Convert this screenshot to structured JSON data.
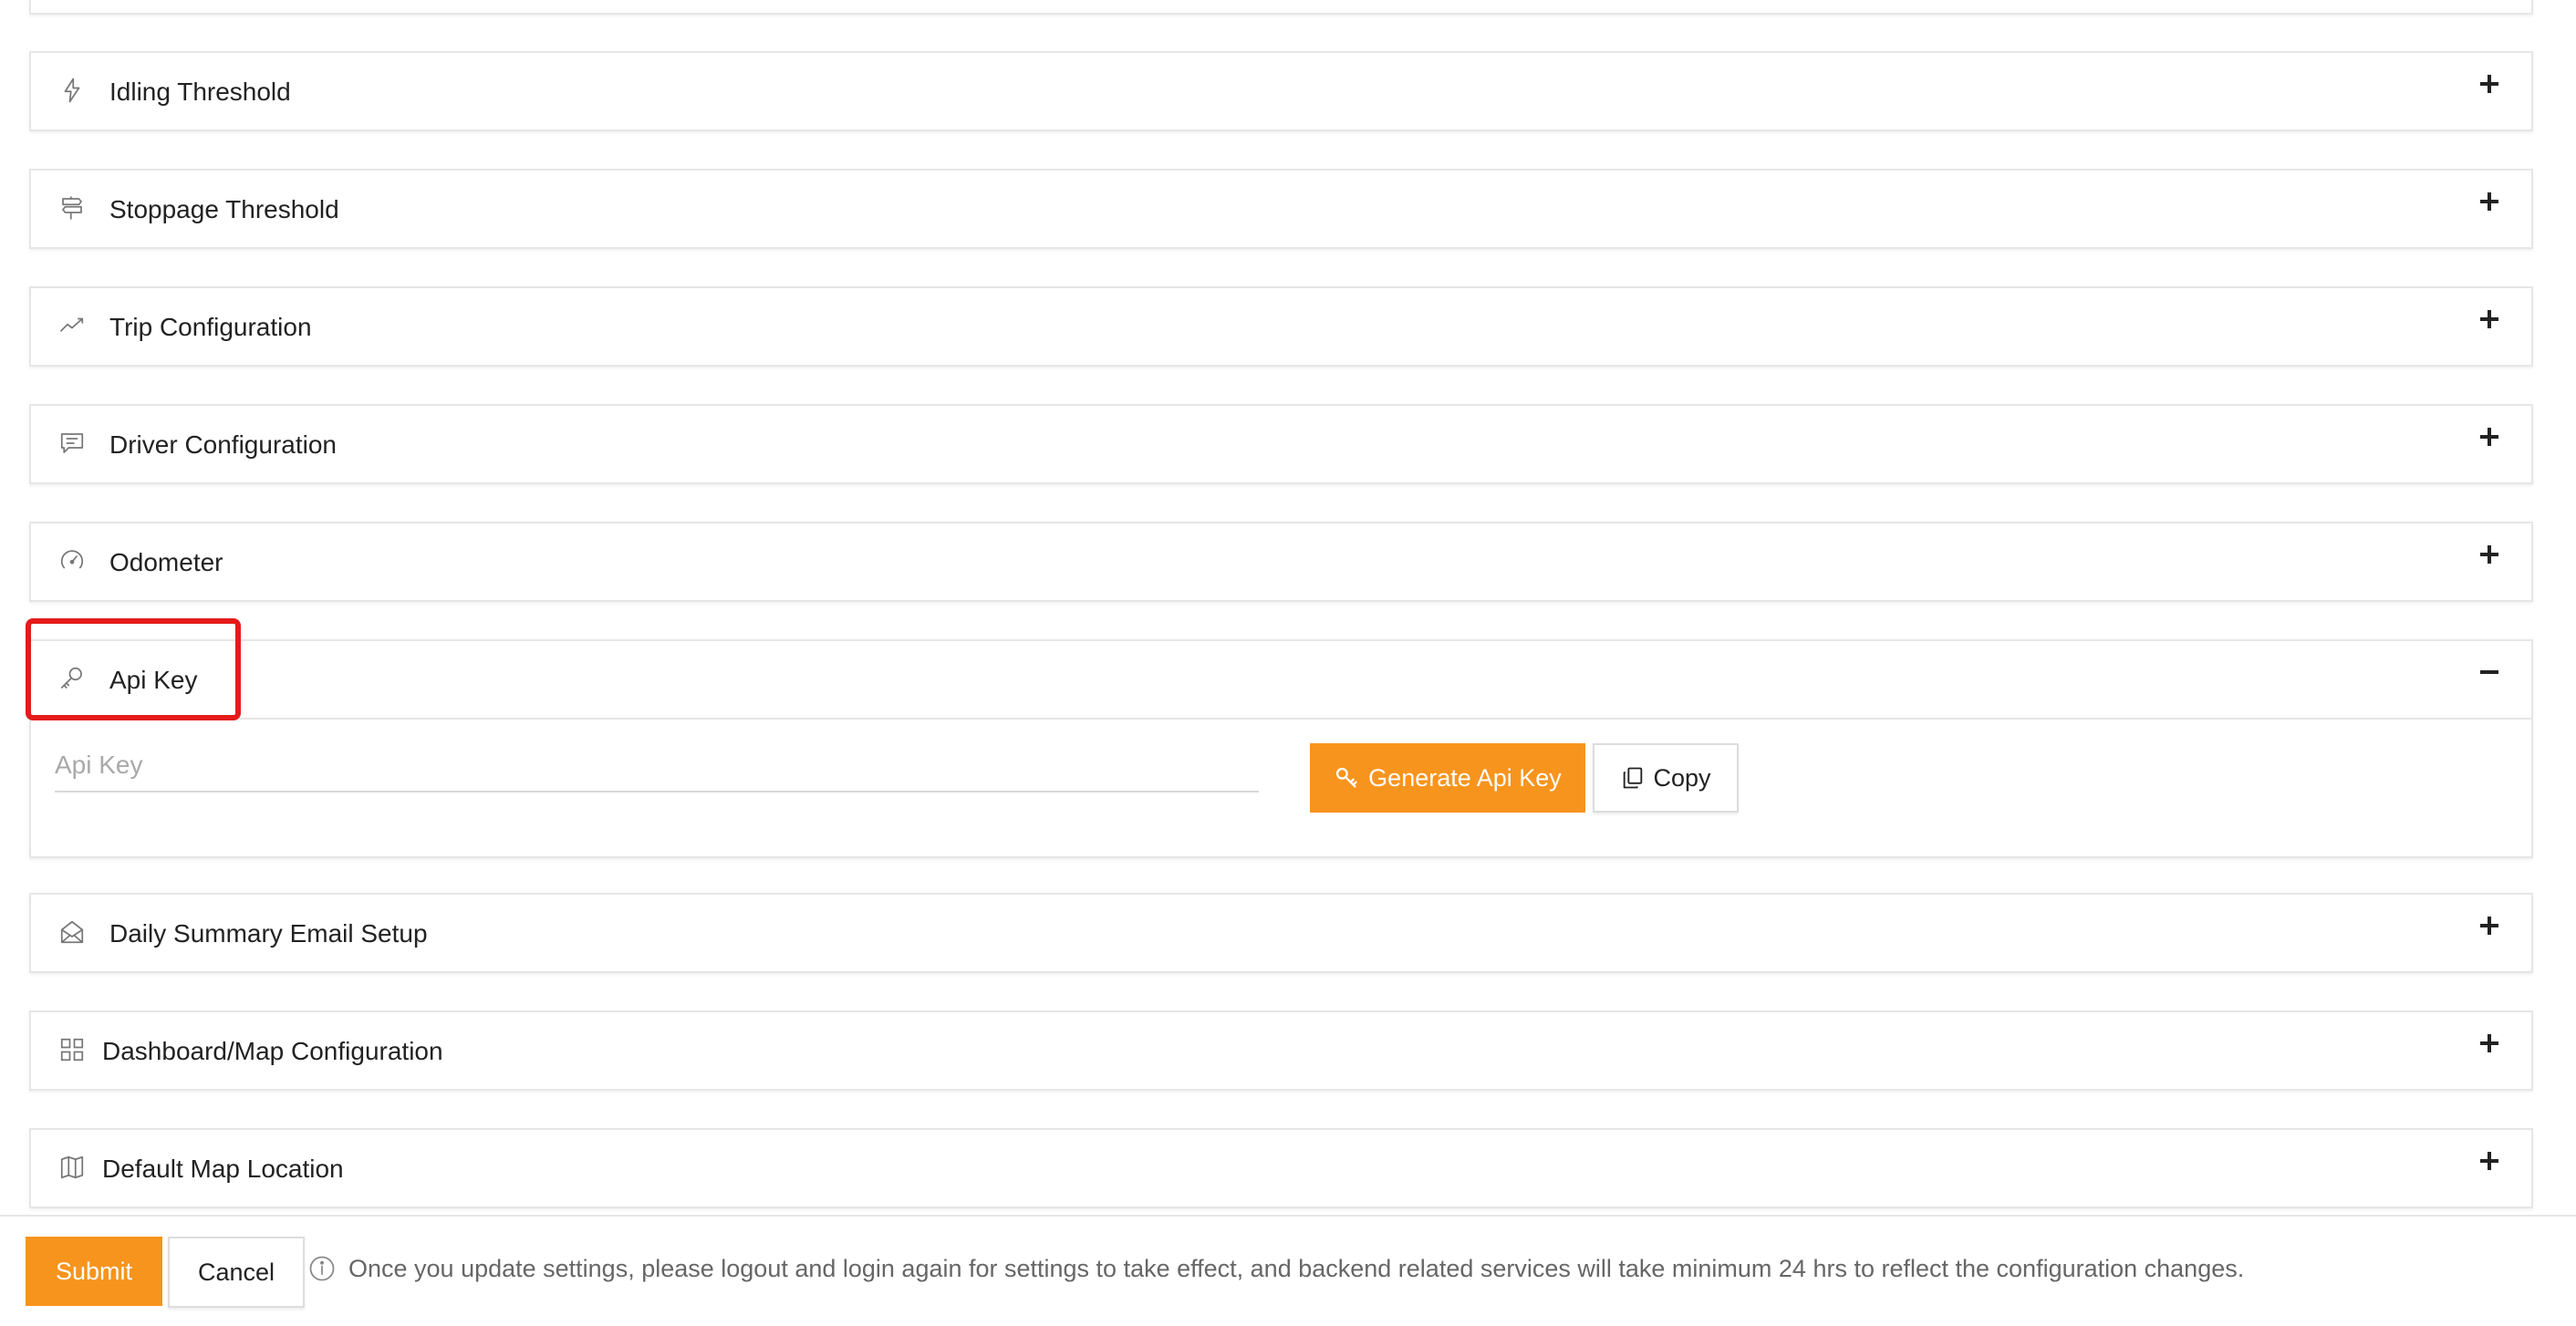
{
  "panels": [
    {
      "title": "Idling Threshold",
      "icon": "lightning-icon",
      "state": "collapsed"
    },
    {
      "title": "Stoppage Threshold",
      "icon": "signpost-icon",
      "state": "collapsed"
    },
    {
      "title": "Trip Configuration",
      "icon": "trend-line-icon",
      "state": "collapsed"
    },
    {
      "title": "Driver Configuration",
      "icon": "message-icon",
      "state": "collapsed"
    },
    {
      "title": "Odometer",
      "icon": "gauge-icon",
      "state": "collapsed"
    },
    {
      "title": "Api Key",
      "icon": "key-icon",
      "state": "expanded"
    },
    {
      "title": "Daily Summary Email Setup",
      "icon": "envelope-open-icon",
      "state": "collapsed"
    },
    {
      "title": "Dashboard/Map Configuration",
      "icon": "grid-icon",
      "state": "collapsed"
    },
    {
      "title": "Default Map Location",
      "icon": "map-icon",
      "state": "collapsed"
    }
  ],
  "api_key": {
    "placeholder": "Api Key",
    "value": "",
    "generate_label": "Generate Api Key",
    "copy_label": "Copy"
  },
  "footer": {
    "submit_label": "Submit",
    "cancel_label": "Cancel",
    "info_text": "Once you update settings, please logout and login again for settings to take effect, and backend related services will take minimum 24 hrs to reflect the configuration changes."
  },
  "colors": {
    "accent": "#f7941d",
    "highlight": "#e41b1b",
    "border": "#e6e6e6"
  }
}
